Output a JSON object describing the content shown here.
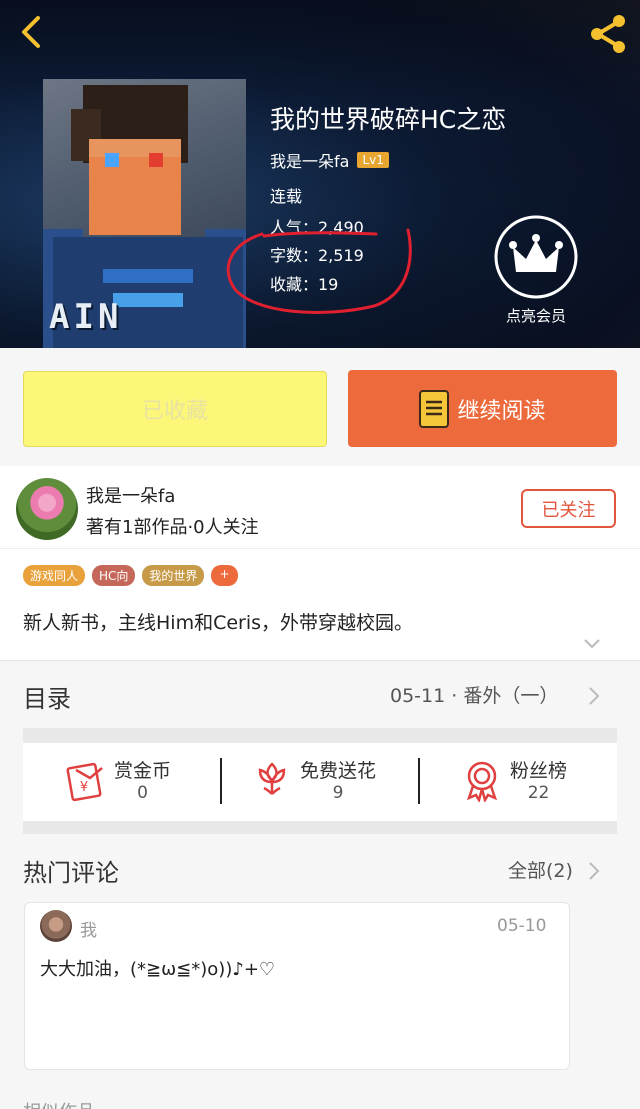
{
  "header": {
    "title": "我的世界破碎HC之恋",
    "author": "我是一朵fa",
    "level": "Lv1",
    "status": "连载",
    "popularity": "人气：2,490",
    "word_count": "字数：2,519",
    "favorites": "收藏：19",
    "vip_label": "点亮会员",
    "cover_text": "AIN",
    "icons": {
      "back": "chevron-left-icon",
      "share": "share-icon",
      "vip": "crown-icon"
    }
  },
  "actions": {
    "collected_label": "已收藏",
    "read_label": "继续阅读",
    "read_icon": "book-icon"
  },
  "author_card": {
    "name": "我是一朵fa",
    "meta": "著有1部作品·0人关注",
    "follow_label": "已关注"
  },
  "tags": [
    "游戏同人",
    "HC向",
    "我的世界",
    "+"
  ],
  "description": "新人新书，主线Him和Ceris，外带穿越校园。",
  "toc": {
    "title": "目录",
    "latest": "05-11 · 番外（一）"
  },
  "stats": [
    {
      "label": "赏金币",
      "value": "0",
      "icon": "red-envelope-yen-icon"
    },
    {
      "label": "免费送花",
      "value": "9",
      "icon": "flower-icon"
    },
    {
      "label": "粉丝榜",
      "value": "22",
      "icon": "medal-icon"
    }
  ],
  "comments": {
    "title": "热门评论",
    "all_label": "全部(2)",
    "items": [
      {
        "user": "我",
        "date": "05-10",
        "text": "大大加油，(*≧ω≦*)o))♪+♡"
      }
    ]
  },
  "similar_label": "相似作品",
  "colors": {
    "accent": "#ec6a3c",
    "collected_bg": "#fdf779",
    "follow": "#e2563d",
    "level_badge": "#e8a630",
    "annotation": "#e0202f"
  }
}
